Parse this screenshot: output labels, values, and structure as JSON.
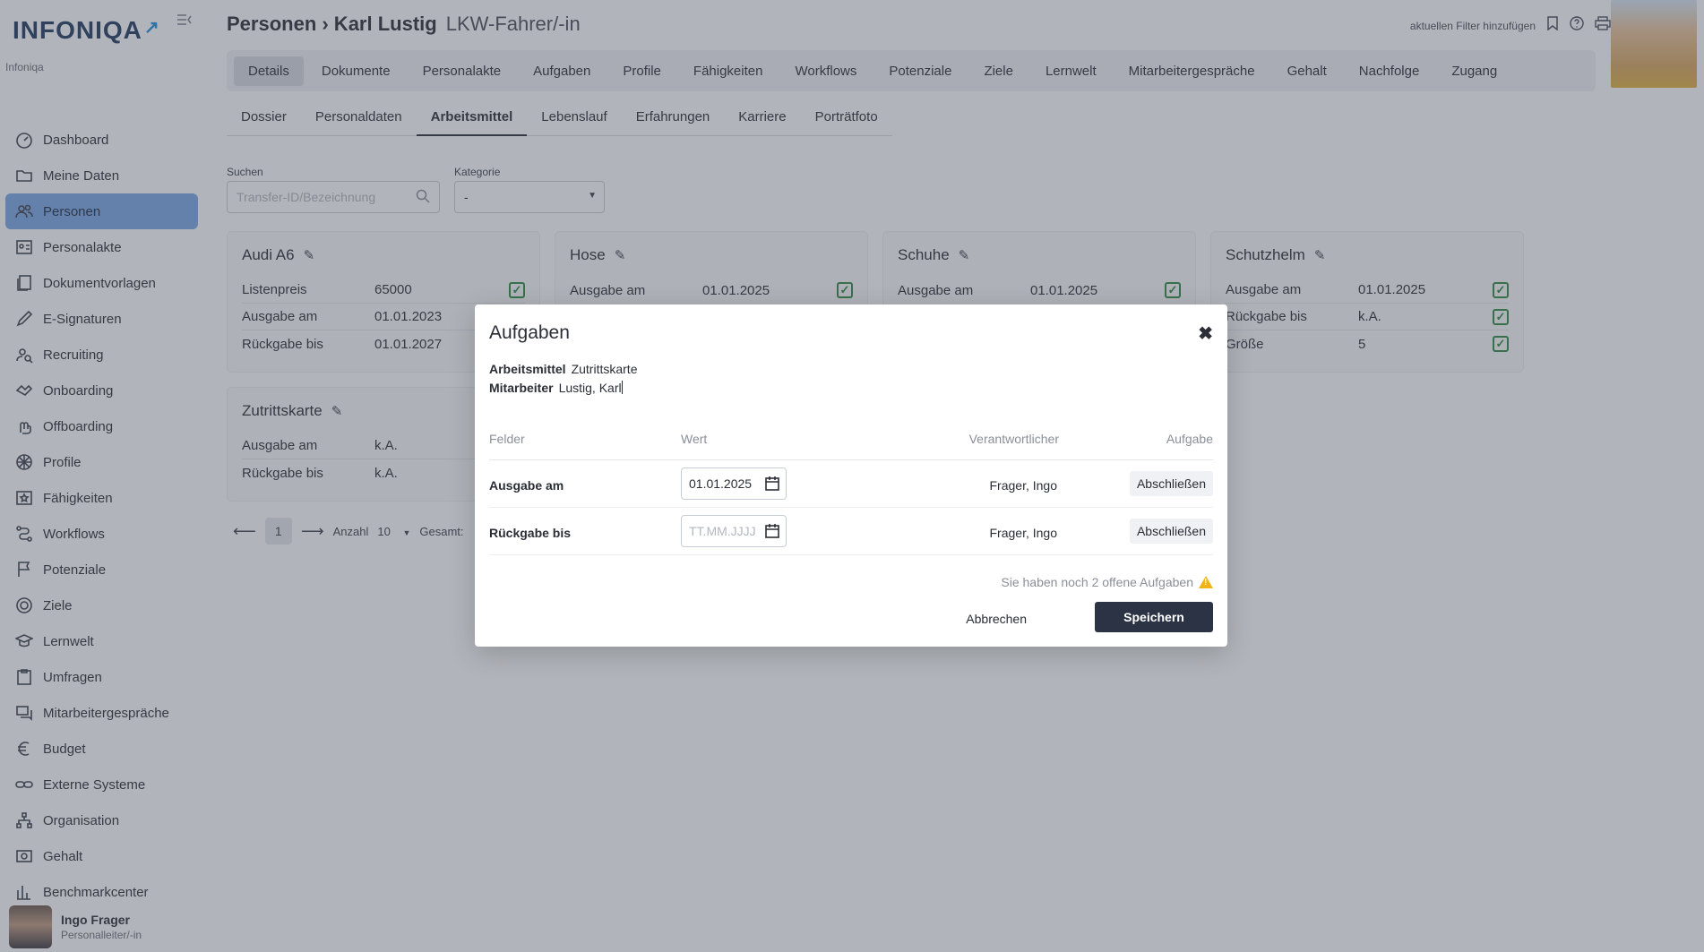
{
  "brand": {
    "logo": "INFONIQA",
    "sub": "Infoniqa"
  },
  "sidebar": {
    "items": [
      {
        "label": "Dashboard",
        "icon": "dashboard-icon"
      },
      {
        "label": "Meine Daten",
        "icon": "folder-icon"
      },
      {
        "label": "Personen",
        "icon": "people-icon",
        "active": true
      },
      {
        "label": "Personalakte",
        "icon": "personnel-file-icon"
      },
      {
        "label": "Dokumentvorlagen",
        "icon": "document-templates-icon"
      },
      {
        "label": "E-Signaturen",
        "icon": "pen-icon"
      },
      {
        "label": "Recruiting",
        "icon": "recruiting-icon"
      },
      {
        "label": "Onboarding",
        "icon": "onboarding-icon"
      },
      {
        "label": "Offboarding",
        "icon": "offboarding-icon"
      },
      {
        "label": "Profile",
        "icon": "profile-icon"
      },
      {
        "label": "Fähigkeiten",
        "icon": "skills-icon"
      },
      {
        "label": "Workflows",
        "icon": "workflow-icon"
      },
      {
        "label": "Potenziale",
        "icon": "flag-icon"
      },
      {
        "label": "Ziele",
        "icon": "target-icon"
      },
      {
        "label": "Lernwelt",
        "icon": "graduation-cap-icon"
      },
      {
        "label": "Umfragen",
        "icon": "clipboard-icon"
      },
      {
        "label": "Mitarbeitergespräche",
        "icon": "conversation-icon"
      },
      {
        "label": "Budget",
        "icon": "euro-icon"
      },
      {
        "label": "Externe Systeme",
        "icon": "link-icon"
      },
      {
        "label": "Organisation",
        "icon": "org-chart-icon"
      },
      {
        "label": "Gehalt",
        "icon": "salary-icon"
      },
      {
        "label": "Benchmarkcenter",
        "icon": "bar-chart-icon"
      }
    ],
    "user": {
      "name": "Ingo Frager",
      "role": "Personalleiter/-in"
    }
  },
  "header": {
    "title": "Personen › Karl Lustig",
    "subtitle": "LKW-Fahrer/-in",
    "filter_link": "aktuellen Filter hinzufügen"
  },
  "main_tabs": [
    "Details",
    "Dokumente",
    "Personalakte",
    "Aufgaben",
    "Profile",
    "Fähigkeiten",
    "Workflows",
    "Potenziale",
    "Ziele",
    "Lernwelt",
    "Mitarbeitergespräche",
    "Gehalt",
    "Nachfolge",
    "Zugang"
  ],
  "sub_tabs": [
    "Dossier",
    "Personaldaten",
    "Arbeitsmittel",
    "Lebenslauf",
    "Erfahrungen",
    "Karriere",
    "Porträtfoto"
  ],
  "filters": {
    "search_label": "Suchen",
    "search_placeholder": "Transfer-ID/Bezeichnung",
    "category_label": "Kategorie",
    "category_value": "-"
  },
  "cards": [
    {
      "title": "Audi A6",
      "rows": [
        {
          "label": "Listenpreis",
          "value": "65000"
        },
        {
          "label": "Ausgabe am",
          "value": "01.01.2023"
        },
        {
          "label": "Rückgabe bis",
          "value": "01.01.2027"
        }
      ]
    },
    {
      "title": "Hose",
      "rows": [
        {
          "label": "Ausgabe am",
          "value": "01.01.2025"
        }
      ]
    },
    {
      "title": "Schuhe",
      "rows": [
        {
          "label": "Ausgabe am",
          "value": "01.01.2025"
        }
      ]
    },
    {
      "title": "Schutzhelm",
      "rows": [
        {
          "label": "Ausgabe am",
          "value": "01.01.2025"
        },
        {
          "label": "Rückgabe bis",
          "value": "k.A."
        },
        {
          "label": "Größe",
          "value": "5"
        }
      ]
    },
    {
      "title": "Zutrittskarte",
      "rows": [
        {
          "label": "Ausgabe am",
          "value": "k.A."
        },
        {
          "label": "Rückgabe bis",
          "value": "k.A."
        }
      ]
    }
  ],
  "pager": {
    "page": "1",
    "count_label": "Anzahl",
    "count_value": "10",
    "total_label": "Gesamt:"
  },
  "modal": {
    "title": "Aufgaben",
    "arbeitsmittel_label": "Arbeitsmittel",
    "arbeitsmittel_value": "Zutrittskarte",
    "mitarbeiter_label": "Mitarbeiter",
    "mitarbeiter_value": "Lustig, Karl",
    "columns": [
      "Felder",
      "Wert",
      "Verantwortlicher",
      "Aufgabe"
    ],
    "rows": [
      {
        "field": "Ausgabe am",
        "value": "01.01.2025",
        "placeholder": "TT.MM.JJJJ",
        "responsible": "Frager, Ingo",
        "task": "Abschließen"
      },
      {
        "field": "Rückgabe bis",
        "value": "",
        "placeholder": "TT.MM.JJJJ",
        "responsible": "Frager, Ingo",
        "task": "Abschließen"
      }
    ],
    "open_tasks": "Sie haben noch 2 offene Aufgaben",
    "cancel": "Abbrechen",
    "save": "Speichern"
  }
}
